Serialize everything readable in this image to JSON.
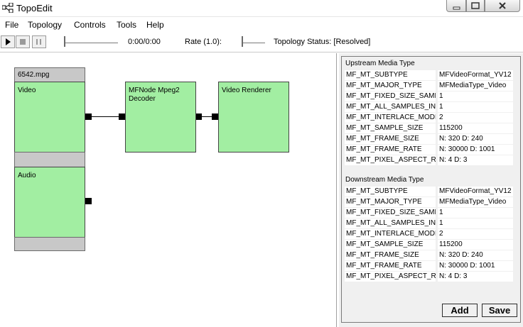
{
  "window": {
    "title": "TopoEdit"
  },
  "menu": [
    {
      "label": "File"
    },
    {
      "label": "Topology"
    },
    {
      "label": "Controls"
    },
    {
      "label": "Tools"
    },
    {
      "label": "Help"
    }
  ],
  "toolbar": {
    "time": "0:00/0:00",
    "rate_label": "Rate (1.0):",
    "status": "Topology Status: [Resolved]"
  },
  "topology": {
    "source_file": "6542.mpg",
    "source_streams": [
      "Video",
      "Audio"
    ],
    "decoder": "MFNode Mpeg2 Decoder",
    "renderer": "Video Renderer"
  },
  "upstream": {
    "title": "Upstream Media Type",
    "rows": [
      {
        "key": "MF_MT_SUBTYPE",
        "value": "MFVideoFormat_YV12"
      },
      {
        "key": "MF_MT_MAJOR_TYPE",
        "value": "MFMediaType_Video"
      },
      {
        "key": "MF_MT_FIXED_SIZE_SAMPLES",
        "value": "1"
      },
      {
        "key": "MF_MT_ALL_SAMPLES_INDEPENDENT",
        "value": "1"
      },
      {
        "key": "MF_MT_INTERLACE_MODE",
        "value": "2"
      },
      {
        "key": "MF_MT_SAMPLE_SIZE",
        "value": "115200"
      },
      {
        "key": "MF_MT_FRAME_SIZE",
        "value": "N: 320  D: 240"
      },
      {
        "key": "MF_MT_FRAME_RATE",
        "value": "N: 30000  D: 1001"
      },
      {
        "key": "MF_MT_PIXEL_ASPECT_RATIO",
        "value": "N: 4  D: 3"
      }
    ]
  },
  "downstream": {
    "title": "Downstream Media Type",
    "rows": [
      {
        "key": "MF_MT_SUBTYPE",
        "value": "MFVideoFormat_YV12"
      },
      {
        "key": "MF_MT_MAJOR_TYPE",
        "value": "MFMediaType_Video"
      },
      {
        "key": "MF_MT_FIXED_SIZE_SAMPLES",
        "value": "1"
      },
      {
        "key": "MF_MT_ALL_SAMPLES_INDEPENDENT",
        "value": "1"
      },
      {
        "key": "MF_MT_INTERLACE_MODE",
        "value": "2"
      },
      {
        "key": "MF_MT_SAMPLE_SIZE",
        "value": "115200"
      },
      {
        "key": "MF_MT_FRAME_SIZE",
        "value": "N: 320  D: 240"
      },
      {
        "key": "MF_MT_FRAME_RATE",
        "value": "N: 30000  D: 1001"
      },
      {
        "key": "MF_MT_PIXEL_ASPECT_RATIO",
        "value": "N: 4  D: 3"
      }
    ]
  },
  "buttons": {
    "add": "Add",
    "save": "Save"
  },
  "colors": {
    "node_fill": "#a2eea2",
    "header_gray": "#c8c8c8"
  }
}
